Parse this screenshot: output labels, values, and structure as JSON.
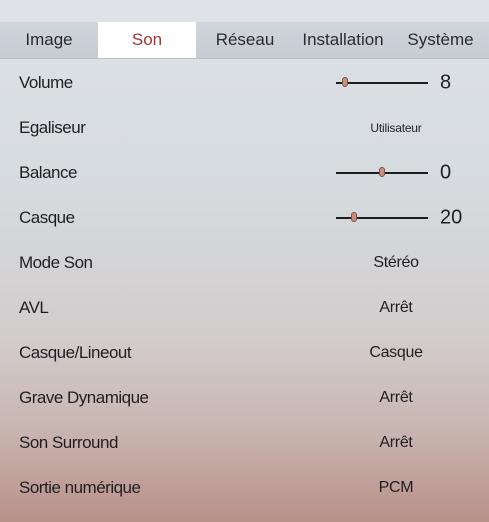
{
  "tabs": [
    {
      "label": "Image",
      "active": false
    },
    {
      "label": "Son",
      "active": true
    },
    {
      "label": "Réseau",
      "active": false
    },
    {
      "label": "Installation",
      "active": false
    },
    {
      "label": "Système",
      "active": false
    }
  ],
  "rows": [
    {
      "label": "Volume",
      "type": "slider",
      "value": "8",
      "level": 0.1
    },
    {
      "label": "Egaliseur",
      "type": "option",
      "value": "Utilisateur"
    },
    {
      "label": "Balance",
      "type": "slider",
      "value": "0",
      "level": 0.5
    },
    {
      "label": "Casque",
      "type": "slider",
      "value": "20",
      "level": 0.2
    },
    {
      "label": "Mode Son",
      "type": "option",
      "value": "Stéréo"
    },
    {
      "label": "AVL",
      "type": "option",
      "value": "Arrêt"
    },
    {
      "label": "Casque/Lineout",
      "type": "option",
      "value": "Casque"
    },
    {
      "label": "Grave Dynamique",
      "type": "option",
      "value": "Arrêt"
    },
    {
      "label": "Son Surround",
      "type": "option",
      "value": "Arrêt"
    },
    {
      "label": "Sortie numérique",
      "type": "option",
      "value": "PCM"
    }
  ],
  "colors": {
    "active_tab_text": "#a3342c",
    "active_tab_bg": "#ffffff",
    "slider_thumb": "#c98d7c"
  }
}
